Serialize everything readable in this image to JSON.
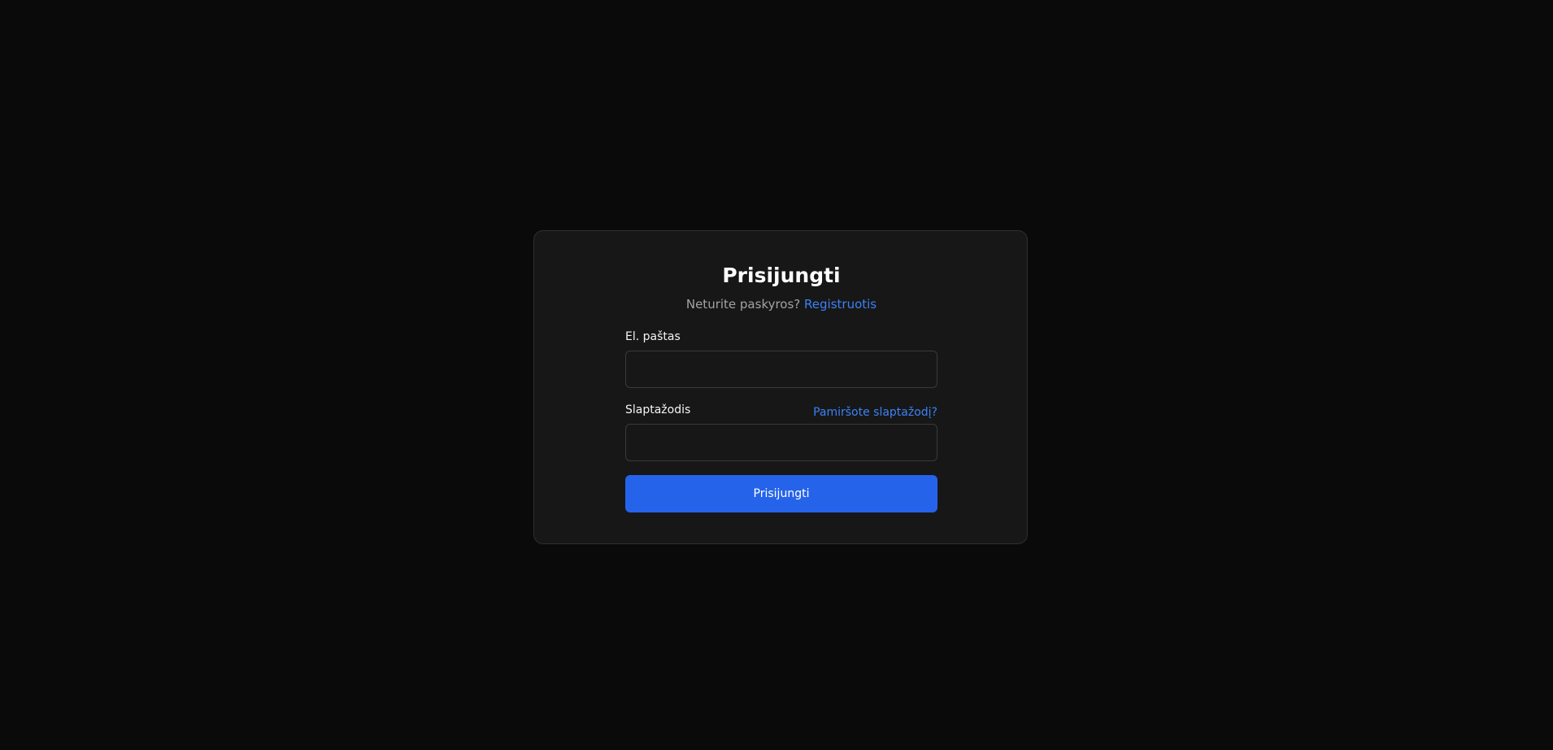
{
  "login": {
    "title": "Prisijungti",
    "no_account_text": "Neturite paskyros?",
    "register_link": "Registruotis",
    "email_label": "El. paštas",
    "email_value": "",
    "password_label": "Slaptažodis",
    "password_value": "",
    "forgot_link": "Pamiršote slaptažodį?",
    "submit_label": "Prisijungti"
  },
  "colors": {
    "background": "#0a0a0a",
    "card": "#171717",
    "accent": "#2563eb",
    "link": "#3b82f6"
  }
}
